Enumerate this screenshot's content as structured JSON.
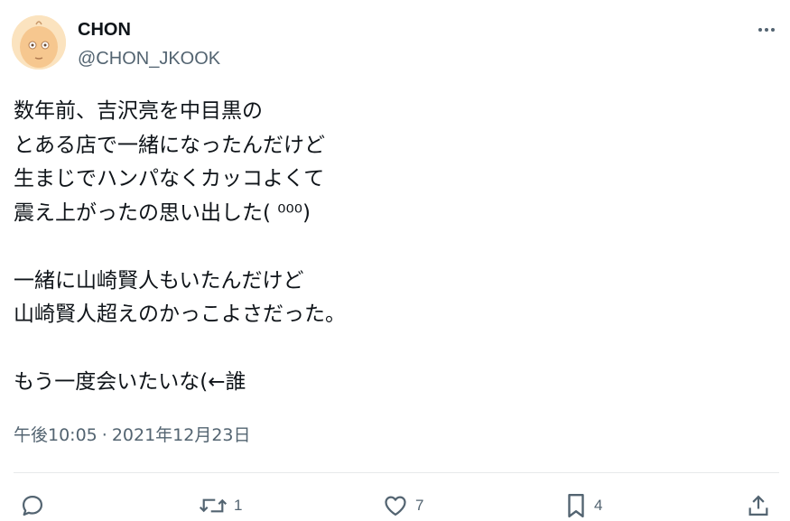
{
  "author": {
    "display_name": "CHON",
    "handle": "@CHON_JKOOK"
  },
  "tweet": {
    "lines": [
      "数年前、吉沢亮を中目黒の",
      "とある店で一緒になったんだけど",
      "生まじでハンパなくカッコよくて",
      "震え上がったの思い出した( ⁰⁰⁰)",
      "",
      "一緒に山崎賢人もいたんだけど",
      "山崎賢人超えのかっこよさだった。",
      "",
      "もう一度会いたいな(←誰"
    ],
    "time": "午後10:05",
    "separator": "·",
    "date": "2021年12月23日"
  },
  "actions": {
    "retweets": "1",
    "likes": "7",
    "bookmarks": "4"
  },
  "icons": [
    "avatar",
    "more-icon",
    "reply-icon",
    "retweet-icon",
    "like-icon",
    "bookmark-icon",
    "share-icon"
  ],
  "colors": {
    "text": "#0f1419",
    "muted": "#536471",
    "divider": "#e7e9ea"
  }
}
